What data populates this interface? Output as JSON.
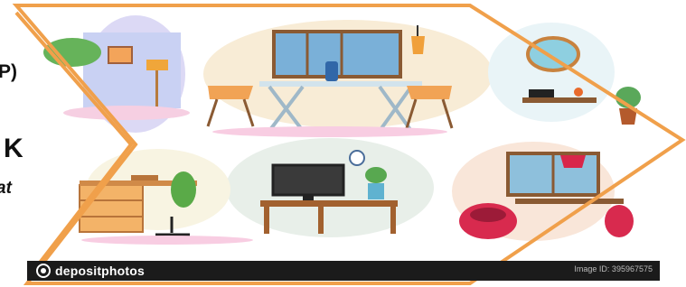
{
  "left_text": {
    "line1": "P)",
    "line2": "K",
    "line3": "at"
  },
  "footer": {
    "brand": "depositphotos",
    "image_id": "Image ID: 395967575"
  },
  "colors": {
    "frame_orange": "#f0a04b",
    "background": "#ffffff",
    "footer_bg": "#1b1b1b",
    "accent_red": "#e0324a"
  },
  "illustration": {
    "subject": "office furniture set",
    "icons": [
      "plant-icon",
      "lamp-icon",
      "chair-icon",
      "table-icon",
      "window-icon",
      "mirror-icon",
      "clock-icon",
      "tv-icon",
      "desk-icon",
      "beanbag-icon"
    ]
  }
}
